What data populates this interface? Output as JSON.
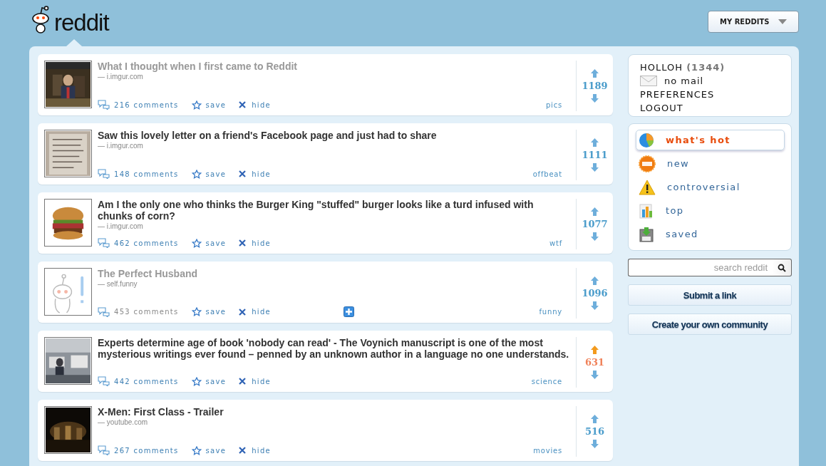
{
  "header": {
    "logo": "reddit",
    "menu": "MY REDDITS"
  },
  "posts": [
    {
      "title": "What I thought when I first came to Reddit",
      "visited": true,
      "domain": "— i.imgur.com",
      "comments": "216 comments",
      "comments_visited": false,
      "save": "save",
      "hide": "hide",
      "expando": false,
      "subreddit": "pics",
      "score": "1189",
      "upvoted": false
    },
    {
      "title": "Saw this lovely letter on a friend's Facebook page and just had to share",
      "visited": false,
      "domain": "— i.imgur.com",
      "comments": "148 comments",
      "comments_visited": false,
      "save": "save",
      "hide": "hide",
      "expando": false,
      "subreddit": "offbeat",
      "score": "1111",
      "upvoted": false
    },
    {
      "title": "Am I the only one who thinks the Burger King \"stuffed\" burger looks like a turd infused with chunks of corn?",
      "visited": false,
      "domain": "— i.imgur.com",
      "comments": "462 comments",
      "comments_visited": false,
      "save": "save",
      "hide": "hide",
      "expando": false,
      "subreddit": "wtf",
      "score": "1077",
      "upvoted": false
    },
    {
      "thumb": {
        "kind": "self"
      },
      "title": "The Perfect Husband",
      "visited": true,
      "domain": "— self.funny",
      "comments": "453 comments",
      "comments_visited": true,
      "save": "save",
      "hide": "hide",
      "expando": true,
      "subreddit": "funny",
      "score": "1096",
      "upvoted": false
    },
    {
      "title": "Experts determine age of book 'nobody can read' - The Voynich manuscript is one of the most mysterious writings ever found – penned by an unknown author in a language no one understands.",
      "visited": false,
      "comments": "442 comments",
      "comments_visited": false,
      "save": "save",
      "hide": "hide",
      "expando": false,
      "subreddit": "science",
      "score": "631",
      "upvoted": true
    },
    {
      "title": "X-Men: First Class - Trailer",
      "visited": false,
      "domain": "— youtube.com",
      "comments": "267 comments",
      "comments_visited": false,
      "save": "save",
      "hide": "hide",
      "expando": false,
      "subreddit": "movies",
      "score": "516",
      "upvoted": false
    }
  ],
  "user": {
    "name": "HOLLOH",
    "karma": "(1344)",
    "mail": "no mail",
    "links": [
      "PREFERENCES",
      "LOGOUT"
    ]
  },
  "sorts": [
    {
      "label": "what's hot",
      "selected": true
    },
    {
      "label": "new",
      "selected": false
    },
    {
      "label": "controversial",
      "selected": false
    },
    {
      "label": "top",
      "selected": false
    },
    {
      "label": "saved",
      "selected": false
    }
  ],
  "search": {
    "placeholder": "search reddit"
  },
  "buttons": [
    "Submit a link",
    "Create your own community"
  ]
}
